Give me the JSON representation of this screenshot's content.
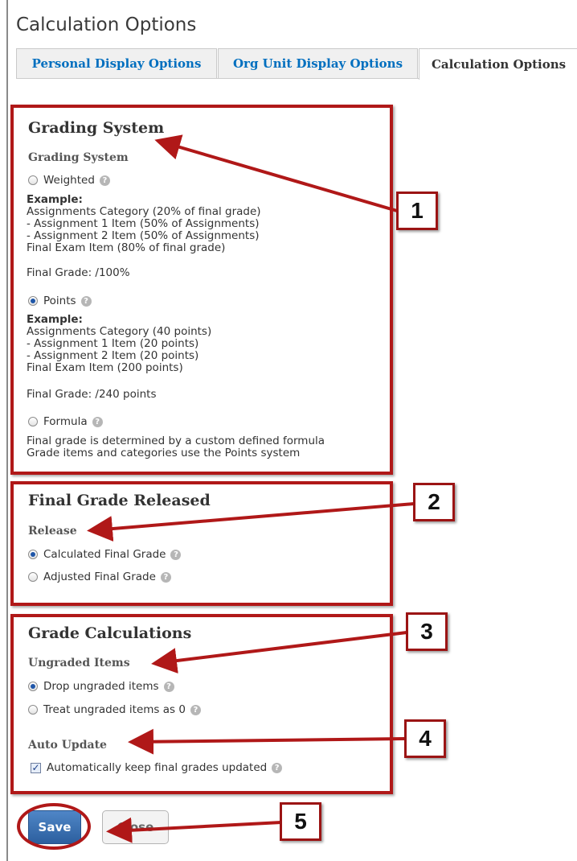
{
  "page": {
    "title": "Calculation Options"
  },
  "tabs": [
    {
      "label": "Personal Display Options"
    },
    {
      "label": "Org Unit Display Options"
    },
    {
      "label": "Calculation Options"
    }
  ],
  "grading_system": {
    "section_title": "Grading System",
    "sub_label": "Grading System",
    "options": {
      "weighted": {
        "label": "Weighted",
        "checked": false,
        "example_heading": "Example:",
        "example_lines": [
          "Assignments Category (20% of final grade)",
          "- Assignment 1 Item (50% of Assignments)",
          "- Assignment 2 Item (50% of Assignments)",
          "Final Exam Item (80% of final grade)"
        ],
        "final_grade": "Final Grade: /100%"
      },
      "points": {
        "label": "Points",
        "checked": true,
        "example_heading": "Example:",
        "example_lines": [
          "Assignments Category (40 points)",
          "- Assignment 1 Item (20 points)",
          "- Assignment 2 Item (20 points)",
          "Final Exam Item (200 points)"
        ],
        "final_grade": "Final Grade: /240 points"
      },
      "formula": {
        "label": "Formula",
        "checked": false,
        "description_lines": [
          "Final grade is determined by a custom defined formula",
          "Grade items and categories use the Points system"
        ]
      }
    }
  },
  "final_grade_released": {
    "section_title": "Final Grade Released",
    "sub_label": "Release",
    "options": [
      {
        "label": "Calculated Final Grade",
        "checked": true
      },
      {
        "label": "Adjusted Final Grade",
        "checked": false
      }
    ]
  },
  "grade_calculations": {
    "section_title": "Grade Calculations",
    "ungraded_label": "Ungraded Items",
    "ungraded_options": [
      {
        "label": "Drop ungraded items",
        "checked": true
      },
      {
        "label": "Treat ungraded items as 0",
        "checked": false
      }
    ],
    "auto_update_label": "Auto Update",
    "auto_update_checkbox": {
      "label": "Automatically keep final grades updated",
      "checked": true
    }
  },
  "buttons": {
    "save": "Save",
    "close": "Close"
  },
  "callouts": [
    "1",
    "2",
    "3",
    "4",
    "5"
  ],
  "help_icon_glyph": "?",
  "checkmark_glyph": "✓",
  "colors": {
    "annotation_red": "#b01818",
    "tab_link": "#006fbf",
    "save_button": "#2c5f9e"
  }
}
